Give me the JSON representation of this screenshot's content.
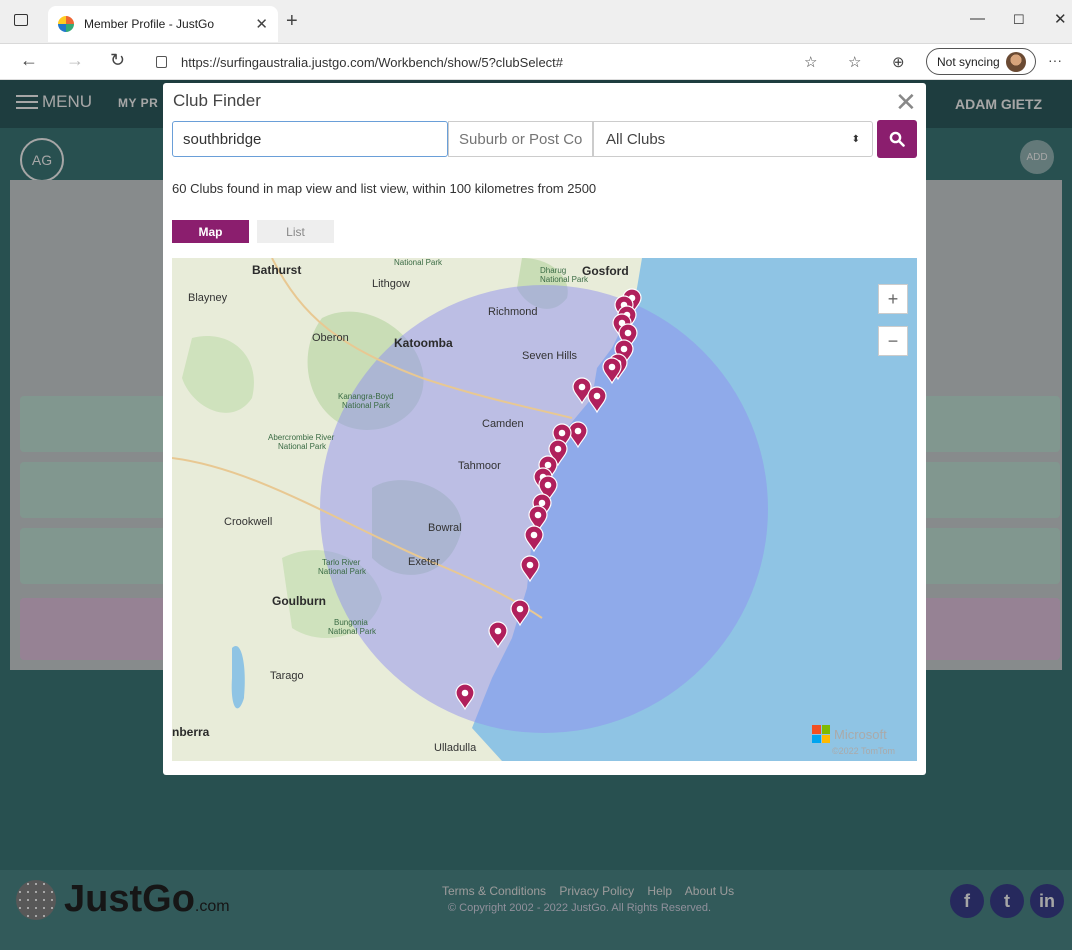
{
  "browser": {
    "tab_title": "Member Profile - JustGo",
    "new_tab": "+",
    "url": "https://surfingaustralia.justgo.com/Workbench/show/5?clubSelect#",
    "sync_label": "Not syncing"
  },
  "app": {
    "menu_label": "MENU",
    "my_profile": "MY PR",
    "user_name": "ADAM GIETZ",
    "avatar_initials": "AG",
    "add_label": "ADD"
  },
  "modal": {
    "title": "Club Finder",
    "search_value": "southbridge",
    "suburb_placeholder": "Suburb or Post Co",
    "club_select": "All Clubs",
    "result_text": "60 Clubs found in map view and list view, within 100 kilometres from 2500",
    "tab_map": "Map",
    "tab_list": "List"
  },
  "map": {
    "zoom_in": "+",
    "zoom_out": "−",
    "labels": {
      "bathurst": "Bathurst",
      "blayney": "Blayney",
      "lithgow": "Lithgow",
      "natpark": "National Park",
      "dharug": "Dharug",
      "dharug_np": "National Park",
      "gosford": "Gosford",
      "richmond": "Richmond",
      "oberon": "Oberon",
      "katoomba": "Katoomba",
      "sevenhills": "Seven Hills",
      "kanangra": "Kanangra-Boyd",
      "kanangra_np": "National Park",
      "camden": "Camden",
      "abercrombie": "Abercrombie River",
      "abercrombie_np": "National Park",
      "tahmoor": "Tahmoor",
      "crookwell": "Crookwell",
      "bowral": "Bowral",
      "tarlo": "Tarlo River",
      "tarlo_np": "National Park",
      "exeter": "Exeter",
      "goulburn": "Goulburn",
      "bungonia": "Bungonia",
      "bungonia_np": "National Park",
      "tarago": "Tarago",
      "canberra": "nberra",
      "ulladulla": "Ulladulla"
    },
    "attribution": "Microsoft",
    "copyright": "©2022 TomTom",
    "pin_color": "#b0205c",
    "radius_color": "#8f8ff0"
  },
  "footer": {
    "brand": "JustGo",
    "brand_suffix": ".com",
    "links": [
      "Terms & Conditions",
      "Privacy Policy",
      "Help",
      "About Us"
    ],
    "copyright": "© Copyright 2002 - 2022 JustGo. All Rights Reserved."
  }
}
